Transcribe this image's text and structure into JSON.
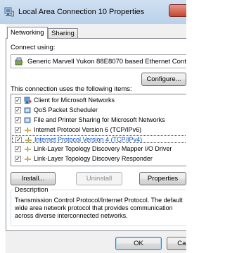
{
  "window": {
    "title": "Local Area Connection 10 Properties"
  },
  "tabs": [
    {
      "label": "Networking",
      "selected": true
    },
    {
      "label": "Sharing",
      "selected": false
    }
  ],
  "connect_using": {
    "label": "Connect using:",
    "adapter": "Generic Marvell Yukon 88E8070 based Ethernet Controlle",
    "configure_label": "Configure..."
  },
  "items_label": "This connection uses the following items:",
  "items": [
    {
      "label": "Client for Microsoft Networks",
      "checked": true,
      "icon": "network-client-icon"
    },
    {
      "label": "QoS Packet Scheduler",
      "checked": true,
      "icon": "service-icon"
    },
    {
      "label": "File and Printer Sharing for Microsoft Networks",
      "checked": true,
      "icon": "service-icon"
    },
    {
      "label": "Internet Protocol Version 6 (TCP/IPv6)",
      "checked": true,
      "icon": "protocol-icon"
    },
    {
      "label": "Internet Protocol Version 4 (TCP/IPv4)",
      "checked": true,
      "icon": "protocol-icon",
      "selected": true
    },
    {
      "label": "Link-Layer Topology Discovery Mapper I/O Driver",
      "checked": true,
      "icon": "protocol-icon"
    },
    {
      "label": "Link-Layer Topology Discovery Responder",
      "checked": true,
      "icon": "protocol-icon"
    }
  ],
  "buttons": {
    "install": "Install...",
    "uninstall": "Uninstall",
    "properties": "Properties",
    "ok": "OK",
    "cancel": "Cancel"
  },
  "description": {
    "title": "Description",
    "text": "Transmission Control Protocol/Internet Protocol. The default wide area network protocol that provides communication across diverse interconnected networks."
  },
  "colors": {
    "selection_text": "#0050c8",
    "close_button": "#c7452f"
  }
}
